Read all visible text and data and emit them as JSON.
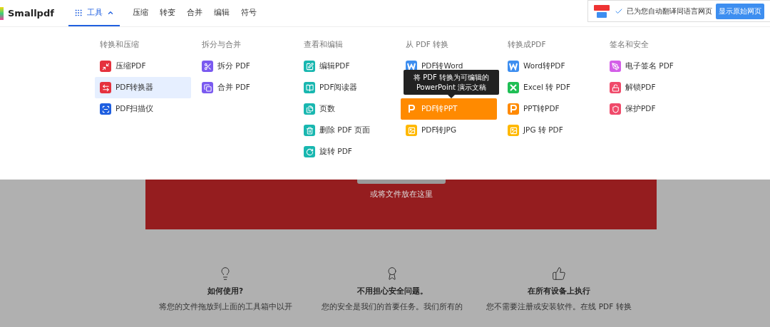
{
  "header": {
    "logo": "Smallpdf",
    "nav": [
      {
        "label": "工具",
        "selected": true,
        "kind": "menu"
      },
      {
        "label": "压缩",
        "selected": false,
        "kind": "link"
      },
      {
        "label": "转变",
        "selected": false,
        "kind": "link"
      },
      {
        "label": "合并",
        "selected": false,
        "kind": "link"
      },
      {
        "label": "编辑",
        "selected": false,
        "kind": "link"
      },
      {
        "label": "符号",
        "selected": false,
        "kind": "link"
      }
    ]
  },
  "translate_bar": {
    "message": "已为您自动翻译同语言网页",
    "button": "显示原始网页"
  },
  "menu": {
    "columns": [
      {
        "title": "转换和压缩",
        "items": [
          {
            "label": "压缩PDF",
            "color": "#e5323e",
            "selected": false,
            "hovered": false
          },
          {
            "label": "PDF转换器",
            "color": "#e5323e",
            "selected": true,
            "hovered": false
          },
          {
            "label": "PDF扫描仪",
            "color": "#1f5fe0",
            "selected": false,
            "hovered": false
          }
        ]
      },
      {
        "title": "拆分与合并",
        "items": [
          {
            "label": "拆分 PDF",
            "color": "#7a5af0",
            "selected": false,
            "hovered": false
          },
          {
            "label": "合并 PDF",
            "color": "#7a5af0",
            "selected": false,
            "hovered": false
          }
        ]
      },
      {
        "title": "查看和编辑",
        "items": [
          {
            "label": "编辑PDF",
            "color": "#19b7b0",
            "selected": false,
            "hovered": false
          },
          {
            "label": "PDF阅读器",
            "color": "#19b7b0",
            "selected": false,
            "hovered": false
          },
          {
            "label": "页数",
            "color": "#19b7b0",
            "selected": false,
            "hovered": false
          },
          {
            "label": "删除 PDF 页面",
            "color": "#19b7b0",
            "selected": false,
            "hovered": false
          },
          {
            "label": "旋转 PDF",
            "color": "#19b7b0",
            "selected": false,
            "hovered": false
          }
        ]
      },
      {
        "title": "从 PDF 转换",
        "items": [
          {
            "label": "PDF转Word",
            "color": "#3d8ef0",
            "selected": false,
            "hovered": false
          },
          {
            "label": "PDF转PPT",
            "color": "#ff8a00",
            "selected": false,
            "hovered": true,
            "tooltip": "将 PDF 转换为可编辑的\nPowerPoint 演示文稿"
          },
          {
            "label": "PDF转JPG",
            "color": "#ffb800",
            "selected": false,
            "hovered": false
          }
        ]
      },
      {
        "title": "转换成PDF",
        "items": [
          {
            "label": "Word转PDF",
            "color": "#3d8ef0",
            "selected": false,
            "hovered": false
          },
          {
            "label": "Excel 转 PDF",
            "color": "#1fbf55",
            "selected": false,
            "hovered": false
          },
          {
            "label": "PPT转PDF",
            "color": "#ff8a00",
            "selected": false,
            "hovered": false
          },
          {
            "label": "JPG 转 PDF",
            "color": "#ffb800",
            "selected": false,
            "hovered": false
          }
        ]
      },
      {
        "title": "签名和安全",
        "items": [
          {
            "label": "电子签名 PDF",
            "color": "#d45ee8",
            "selected": false,
            "hovered": false
          },
          {
            "label": "解锁PDF",
            "color": "#f04a6a",
            "selected": false,
            "hovered": false
          },
          {
            "label": "保护PDF",
            "color": "#f04a6a",
            "selected": false,
            "hovered": false
          }
        ]
      }
    ]
  },
  "dropzone": {
    "hint": "或将文件放在这里"
  },
  "features": [
    {
      "title": "如何使用?",
      "text": "将您的文件拖放到上面的工具箱中以开"
    },
    {
      "title": "不用担心安全问题。",
      "text": "您的安全是我们的首要任务。我们所有的"
    },
    {
      "title": "在所有设备上执行",
      "text": "您不需要注册或安装软件。在线 PDF 转换"
    }
  ]
}
